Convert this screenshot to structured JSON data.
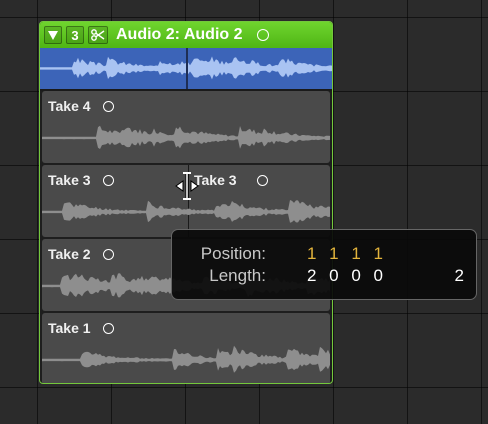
{
  "folder": {
    "collapse_icon": "triangle-down-icon",
    "take_count": "3",
    "scissors_icon": "scissors-icon",
    "title": "Audio 2: Audio 2"
  },
  "takes": [
    {
      "label": "Take 4"
    },
    {
      "label": "Take 3",
      "split_label": "Take 3"
    },
    {
      "label": "Take 2"
    },
    {
      "label": "Take 1"
    }
  ],
  "tooltip": {
    "position_label": "Position:",
    "position_value": "1 1 1 1",
    "length_label": "Length:",
    "length_value": "2 0 0 0",
    "length_extra": "2"
  },
  "colors": {
    "folder_green": "#5fc522",
    "comp_blue": "#3c64b8",
    "position_value": "#e3b43c"
  }
}
